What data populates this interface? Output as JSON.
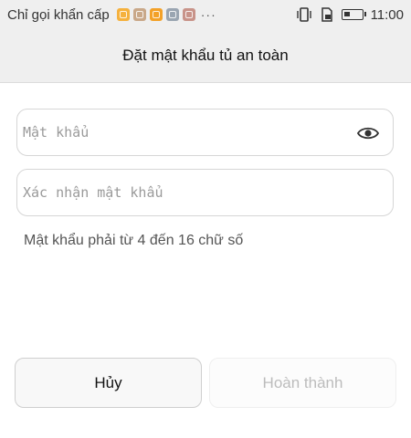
{
  "status_bar": {
    "carrier": "Chỉ gọi khẩn cấp",
    "notification_icons": [
      "keyboard-icon",
      "app-icon",
      "notes-icon",
      "gallery-icon",
      "avatar-icon"
    ],
    "more": "···",
    "time": "11:00"
  },
  "header": {
    "title": "Đặt mật khẩu tủ an toàn"
  },
  "form": {
    "password_placeholder": "Mật khẩu",
    "confirm_placeholder": "Xác nhận mật khẩu",
    "password_value": "",
    "confirm_value": "",
    "hint": "Mật khẩu phải từ 4 đến 16 chữ số"
  },
  "buttons": {
    "cancel": "Hủy",
    "done": "Hoàn thành"
  }
}
